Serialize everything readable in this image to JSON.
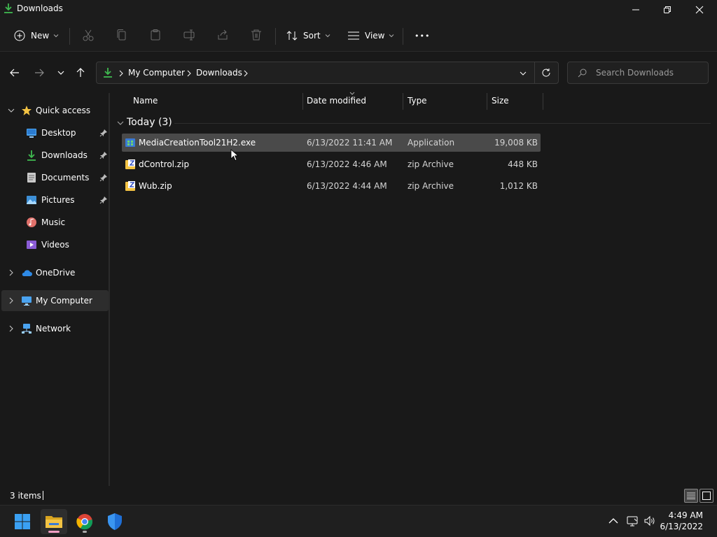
{
  "window": {
    "title": "Downloads"
  },
  "command_bar": {
    "new_label": "New",
    "sort_label": "Sort",
    "view_label": "View",
    "more_label": "•••"
  },
  "address_bar": {
    "segments": [
      "My Computer",
      "Downloads"
    ],
    "search_placeholder": "Search Downloads"
  },
  "sidebar": {
    "quick_access": "Quick access",
    "items": [
      {
        "label": "Desktop",
        "icon": "desktop-icon",
        "pinned": true
      },
      {
        "label": "Downloads",
        "icon": "download-icon",
        "pinned": true
      },
      {
        "label": "Documents",
        "icon": "documents-icon",
        "pinned": true
      },
      {
        "label": "Pictures",
        "icon": "pictures-icon",
        "pinned": true
      },
      {
        "label": "Music",
        "icon": "music-icon",
        "pinned": false
      },
      {
        "label": "Videos",
        "icon": "videos-icon",
        "pinned": false
      }
    ],
    "onedrive": "OneDrive",
    "my_computer": "My Computer",
    "network": "Network"
  },
  "file_list": {
    "columns": [
      "Name",
      "Date modified",
      "Type",
      "Size"
    ],
    "group_label": "Today (3)",
    "rows": [
      {
        "name": "MediaCreationTool21H2.exe",
        "date": "6/13/2022 11:41 AM",
        "type": "Application",
        "size": "19,008 KB",
        "icon": "app-icon",
        "selected": true
      },
      {
        "name": "dControl.zip",
        "date": "6/13/2022 4:46 AM",
        "type": "zip Archive",
        "size": "448 KB",
        "icon": "zip-icon",
        "selected": false
      },
      {
        "name": "Wub.zip",
        "date": "6/13/2022 4:44 AM",
        "type": "zip Archive",
        "size": "1,012 KB",
        "icon": "zip-icon",
        "selected": false
      }
    ]
  },
  "status_bar": {
    "item_count": "3 items"
  },
  "taskbar": {
    "time": "4:49 AM",
    "date": "6/13/2022"
  },
  "colors": {
    "accent": "#60cdff",
    "download_green": "#3fb950",
    "folder_yellow": "#f3c343"
  }
}
